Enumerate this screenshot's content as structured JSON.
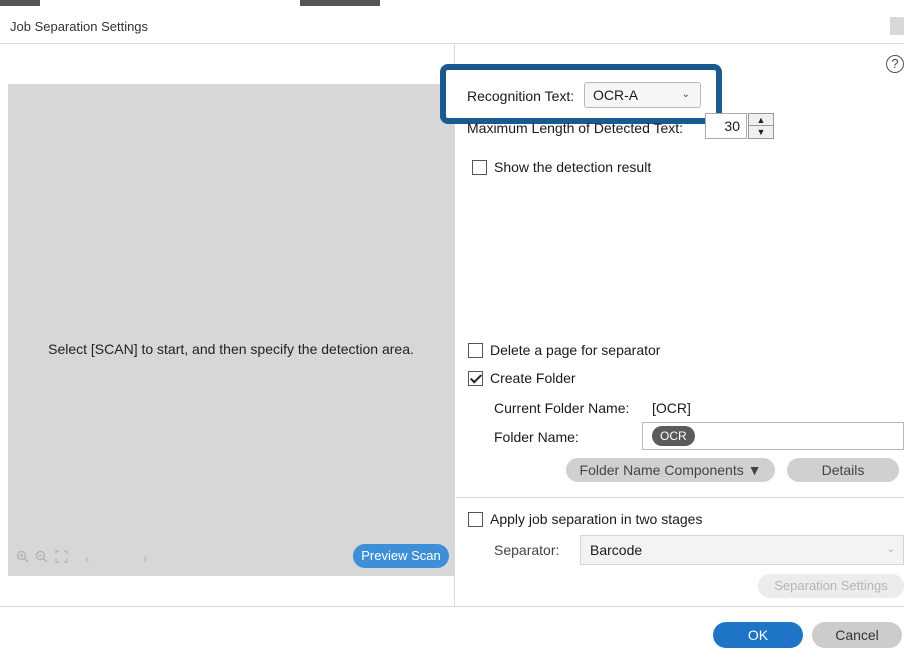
{
  "window": {
    "title": "Job Separation Settings"
  },
  "preview": {
    "message": "Select [SCAN] to start, and then specify the detection area.",
    "tools": [
      "zoom-in-icon",
      "zoom-out-icon",
      "fit-icon",
      "prev-page-icon",
      "next-page-icon"
    ],
    "preview_scan_label": "Preview Scan"
  },
  "settings": {
    "help_glyph": "?",
    "recognition_text": {
      "label": "Recognition Text:",
      "value": "OCR-A"
    },
    "max_length": {
      "label": "Maximum Length of Detected Text:",
      "value": "30"
    },
    "show_detection": {
      "label": "Show the detection result",
      "checked": false
    },
    "delete_page": {
      "label": "Delete a page for separator",
      "checked": false
    },
    "create_folder": {
      "label": "Create Folder",
      "checked": true
    },
    "current_folder": {
      "label": "Current Folder Name:",
      "value": "[OCR]"
    },
    "folder_name": {
      "label": "Folder Name:",
      "chip": "OCR"
    },
    "folder_components_label": "Folder Name Components ▼",
    "details_label": "Details",
    "two_stages": {
      "label": "Apply job separation in two stages",
      "checked": false
    },
    "separator": {
      "label": "Separator:",
      "value": "Barcode"
    },
    "separation_settings_label": "Separation Settings"
  },
  "footer": {
    "ok_label": "OK",
    "cancel_label": "Cancel"
  },
  "colors": {
    "primary_button": "#1e74c6",
    "preview_scan_button": "#3d8fd8",
    "highlight_border": "#1a5a8e",
    "preview_area": "#d7d7d7"
  }
}
